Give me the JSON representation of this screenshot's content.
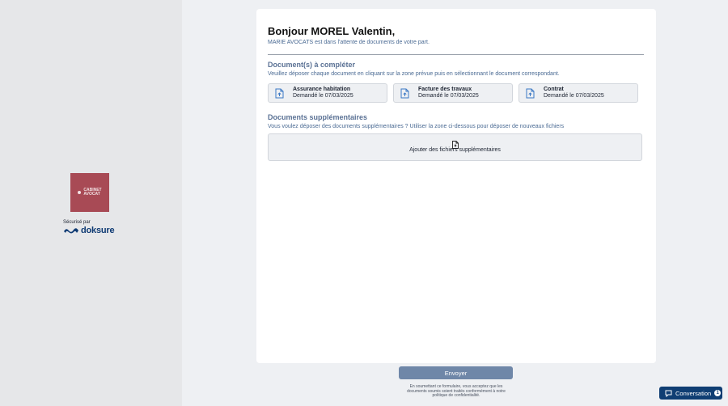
{
  "sidebar": {
    "logo_line1": "CABINET",
    "logo_line2": "AVOCAT",
    "secured_label": "Sécurisé par",
    "brand": "doksure"
  },
  "header": {
    "greeting": "Bonjour MOREL Valentin,",
    "subtitle": "MARIE AVOCATS est dans l'attente de documents de votre part."
  },
  "required": {
    "title": "Document(s) à compléter",
    "description": "Veuillez déposer chaque document en cliquant sur la zone prévue puis en sélectionnant le document correspondant.",
    "documents": [
      {
        "name": "Assurance habitation",
        "requested": "Demandé le 07/03/2025",
        "icon": "file-upload-icon"
      },
      {
        "name": "Facture des travaux",
        "requested": "Demandé le 07/03/2025",
        "icon": "file-upload-icon"
      },
      {
        "name": "Contrat",
        "requested": "Demandé le 07/03/2025",
        "icon": "file-upload-icon"
      }
    ]
  },
  "extra": {
    "title": "Documents supplémentaires",
    "description": "Vous voulez déposer des documents supplémentaires ? Utiliser la zone ci-dessous pour déposer de nouveaux fichiers",
    "add_label": "Ajouter des fichiers supplémentaires"
  },
  "footer": {
    "send_label": "Envoyer",
    "legal": "En soumettant ce formulaire, vous acceptez que les documents soumis soient traités conformément à notre politique de confidentialité."
  },
  "chat": {
    "label": "Conversation",
    "count": "1"
  },
  "colors": {
    "accent": "#0f3e73",
    "section_title": "#5a7194",
    "logo": "#a84a55"
  }
}
